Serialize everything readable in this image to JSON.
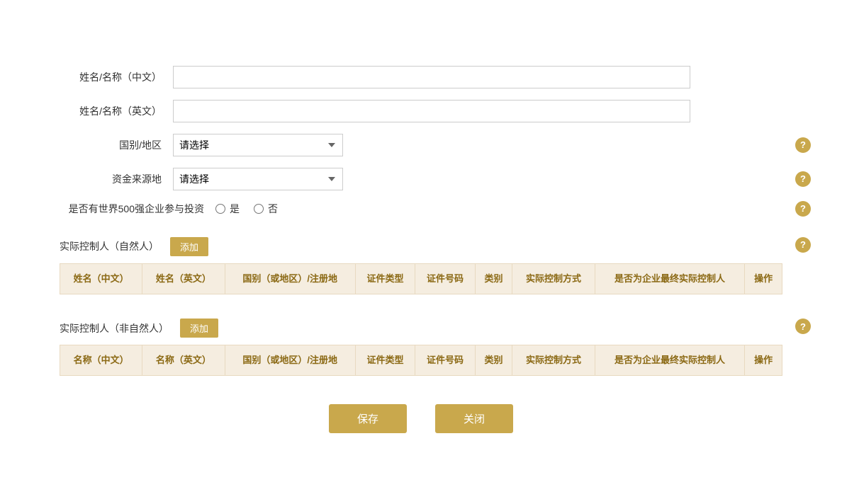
{
  "form": {
    "name_cn_label": "姓名/名称（中文）",
    "name_en_label": "姓名/名称（英文）",
    "country_label": "国别/地区",
    "fund_source_label": "资金来源地",
    "fortune500_label": "是否有世界500强企业参与投资",
    "country_placeholder": "请选择",
    "fund_source_placeholder": "请选择",
    "radio_yes": "是",
    "radio_no": "否"
  },
  "natural_person_section": {
    "title": "实际控制人（自然人）",
    "add_button": "添加",
    "columns": [
      "姓名（中文）",
      "姓名（英文）",
      "国别（或地区）/注册地",
      "证件类型",
      "证件号码",
      "类别",
      "实际控制方式",
      "是否为企业最终实际控制人",
      "操作"
    ]
  },
  "non_natural_person_section": {
    "title": "实际控制人（非自然人）",
    "add_button": "添加",
    "columns": [
      "名称（中文）",
      "名称（英文）",
      "国别（或地区）/注册地",
      "证件类型",
      "证件号码",
      "类别",
      "实际控制方式",
      "是否为企业最终实际控制人",
      "操作"
    ]
  },
  "buttons": {
    "save": "保存",
    "close": "关闭"
  },
  "help_icon": "?",
  "icons": {
    "help": "?"
  }
}
